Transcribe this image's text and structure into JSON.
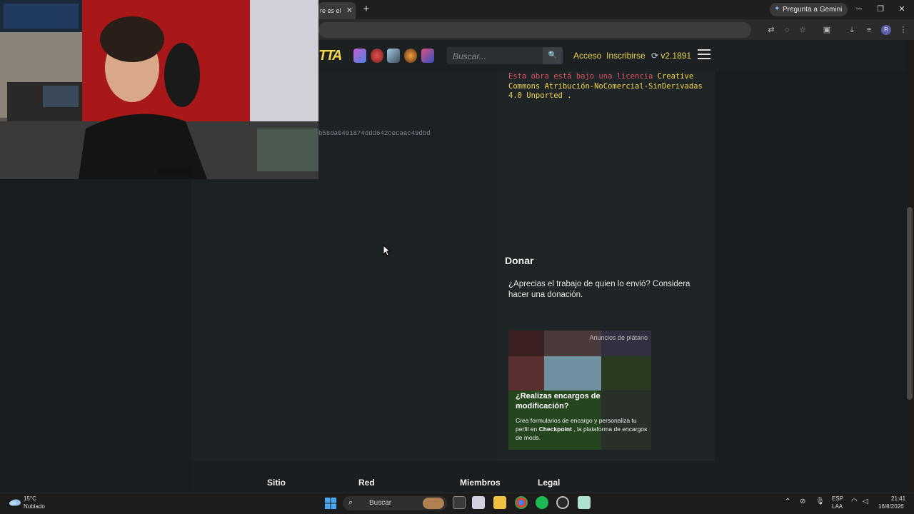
{
  "browser": {
    "tab_title": "re es el",
    "tab_close": "✕",
    "new_tab": "+",
    "gemini_label": "Pregunta a Gemini",
    "profile_initial": "R",
    "window_controls": [
      "─",
      "❐",
      "✕"
    ]
  },
  "site": {
    "logo_text": "TTA",
    "search_placeholder": "Buscar...",
    "nav": {
      "login": "Acceso",
      "signup": "Inscribirse",
      "version": "v2.1891"
    },
    "hash_text": "b58da0491874ddd642cecaac49dbd",
    "license": {
      "prefix": "Esta obra está bajo una licencia",
      "link": "Creative Commons Atribución-NoComercial-SinDerivadas 4.0 Unported",
      "suffix": "."
    },
    "donate": {
      "title": "Donar",
      "text": "¿Aprecias el trabajo de quien lo envió? Considera hacer una donación."
    },
    "ad": {
      "tag": "Anuncios de plátano",
      "title": "¿Realizas encargos de modificación?",
      "body_before": "Crea formularios de encargo y personaliza tu perfil en",
      "body_brand": "Checkpoint",
      "body_after": ", la plataforma de encargos de mods."
    },
    "footer": {
      "sections": [
        "Sitio",
        "Red",
        "Miembros",
        "Legal"
      ]
    }
  },
  "taskbar": {
    "weather_temp": "15°C",
    "weather_desc": "Nublado",
    "search_label": "Buscar",
    "lang_top": "ESP",
    "lang_bottom": "LAA",
    "time": "21:41",
    "date": "16/8/2026"
  },
  "colors": {
    "accent_yellow": "#e6d34a",
    "license_red": "#e05060",
    "page_bg": "#1c2124"
  }
}
